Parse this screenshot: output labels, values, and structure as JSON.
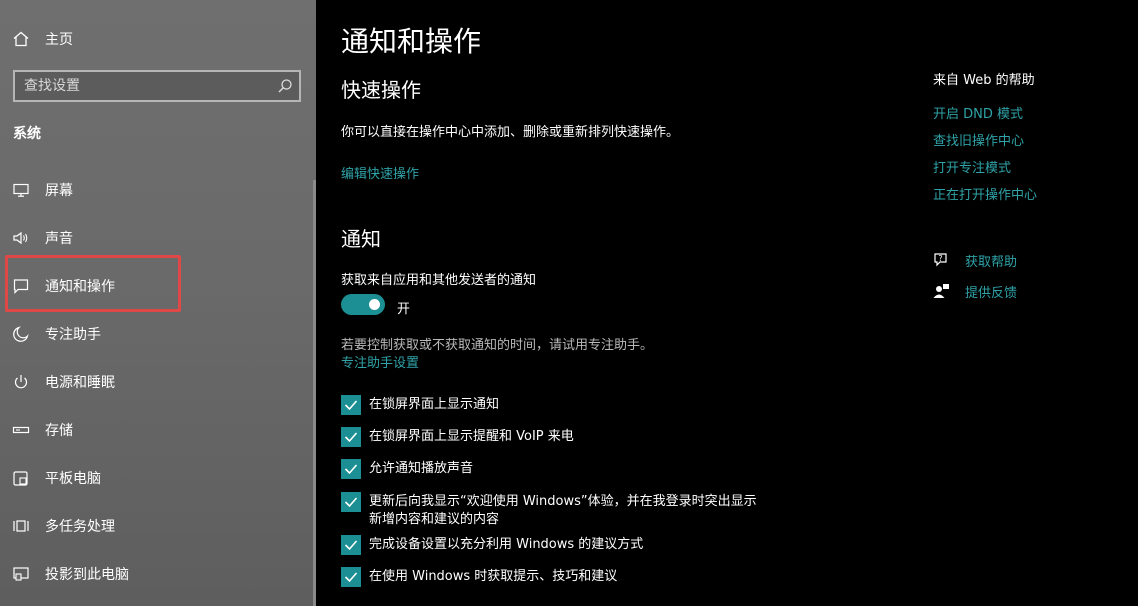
{
  "sidebar": {
    "home_label": "主页",
    "search_placeholder": "查找设置",
    "section_label": "系统",
    "items": [
      {
        "label": "屏幕",
        "icon": "monitor-icon"
      },
      {
        "label": "声音",
        "icon": "speaker-icon"
      },
      {
        "label": "通知和操作",
        "icon": "notification-icon"
      },
      {
        "label": "专注助手",
        "icon": "moon-icon"
      },
      {
        "label": "电源和睡眠",
        "icon": "power-icon"
      },
      {
        "label": "存储",
        "icon": "storage-icon"
      },
      {
        "label": "平板电脑",
        "icon": "tablet-icon"
      },
      {
        "label": "多任务处理",
        "icon": "multitask-icon"
      },
      {
        "label": "投影到此电脑",
        "icon": "project-icon"
      }
    ],
    "selected_item": "通知和操作"
  },
  "main": {
    "title": "通知和操作",
    "quick_actions": {
      "heading": "快速操作",
      "description": "你可以直接在操作中心中添加、删除或重新排列快速操作。",
      "edit_link": "编辑快速操作"
    },
    "notifications": {
      "heading": "通知",
      "toggle_label": "获取来自应用和其他发送者的通知",
      "toggle_state": "开",
      "hint": "若要控制获取或不获取通知的时间，请试用专注助手。",
      "focus_link": "专注助手设置",
      "checkboxes": [
        {
          "line1": "在锁屏界面上显示通知",
          "line2": "",
          "checked": true
        },
        {
          "line1": "在锁屏界面上显示提醒和 VoIP 来电",
          "line2": "",
          "checked": true
        },
        {
          "line1": "允许通知播放声音",
          "line2": "",
          "checked": true
        },
        {
          "line1": "更新后向我显示“欢迎使用 Windows”体验，并在我登录时突出显示",
          "line2": "新增内容和建议的内容",
          "checked": true
        },
        {
          "line1": "完成设备设置以充分利用 Windows 的建议方式",
          "line2": "",
          "checked": true
        },
        {
          "line1": "在使用 Windows 时获取提示、技巧和建议",
          "line2": "",
          "checked": true
        }
      ]
    }
  },
  "help": {
    "title": "来自 Web 的帮助",
    "links": [
      "开启 DND 模式",
      "查找旧操作中心",
      "打开专注模式",
      "正在打开操作中心"
    ],
    "get_help": "获取帮助",
    "feedback": "提供反馈"
  },
  "colors": {
    "accent": "#1c8f94",
    "link": "#2fa3a8",
    "highlight": "#e04848"
  }
}
